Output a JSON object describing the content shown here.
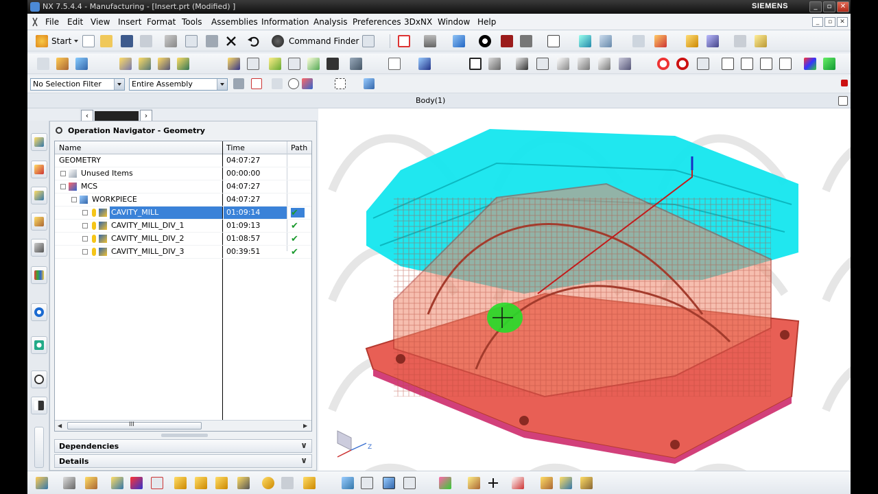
{
  "window": {
    "title": "NX 7.5.4.4 - Manufacturing - [Insert.prt (Modified) ]",
    "brand": "SIEMENS",
    "controls": [
      "_",
      "▫",
      "✕"
    ]
  },
  "menu": {
    "items": [
      "File",
      "Edit",
      "View",
      "Insert",
      "Format",
      "Tools",
      "Assemblies",
      "Information",
      "Analysis",
      "Preferences",
      "3DxNX",
      "Window",
      "Help"
    ]
  },
  "toolbar": {
    "start_label": "Start",
    "command_finder_label": "Command Finder"
  },
  "selection": {
    "filter_value": "No Selection Filter",
    "scope_value": "Entire Assembly"
  },
  "graphics_header": {
    "title": "Body(1)"
  },
  "navigator": {
    "title": "Operation Navigator - Geometry",
    "columns": [
      "Name",
      "Time",
      "Path"
    ],
    "rows": [
      {
        "name": "GEOMETRY",
        "time": "04:07:27",
        "path": "",
        "icon": "none",
        "indent": 0
      },
      {
        "name": "Unused Items",
        "time": "00:00:00",
        "path": "",
        "icon": "folder-icon",
        "indent": 1
      },
      {
        "name": "MCS",
        "time": "04:07:27",
        "path": "",
        "icon": "mcs-icon",
        "indent": 1
      },
      {
        "name": "WORKPIECE",
        "time": "04:07:27",
        "path": "",
        "icon": "workpiece-icon",
        "indent": 2
      },
      {
        "name": "CAVITY_MILL",
        "time": "01:09:14",
        "path": "✔",
        "icon": "operation-icon",
        "indent": 3,
        "selected": true
      },
      {
        "name": "CAVITY_MILL_DIV_1",
        "time": "01:09:13",
        "path": "✔",
        "icon": "operation-icon",
        "indent": 3
      },
      {
        "name": "CAVITY_MILL_DIV_2",
        "time": "01:08:57",
        "path": "✔",
        "icon": "operation-icon",
        "indent": 3
      },
      {
        "name": "CAVITY_MILL_DIV_3",
        "time": "00:39:51",
        "path": "✔",
        "icon": "operation-icon",
        "indent": 3
      }
    ],
    "scroll_mark": "III",
    "sections": [
      "Dependencies",
      "Details"
    ]
  },
  "colors": {
    "toolpath": "#14e6ee",
    "part": "#ea6d57",
    "selection": "#3a82d8",
    "check": "#1b9a2e"
  },
  "triad": {
    "axis_label": "Z"
  }
}
